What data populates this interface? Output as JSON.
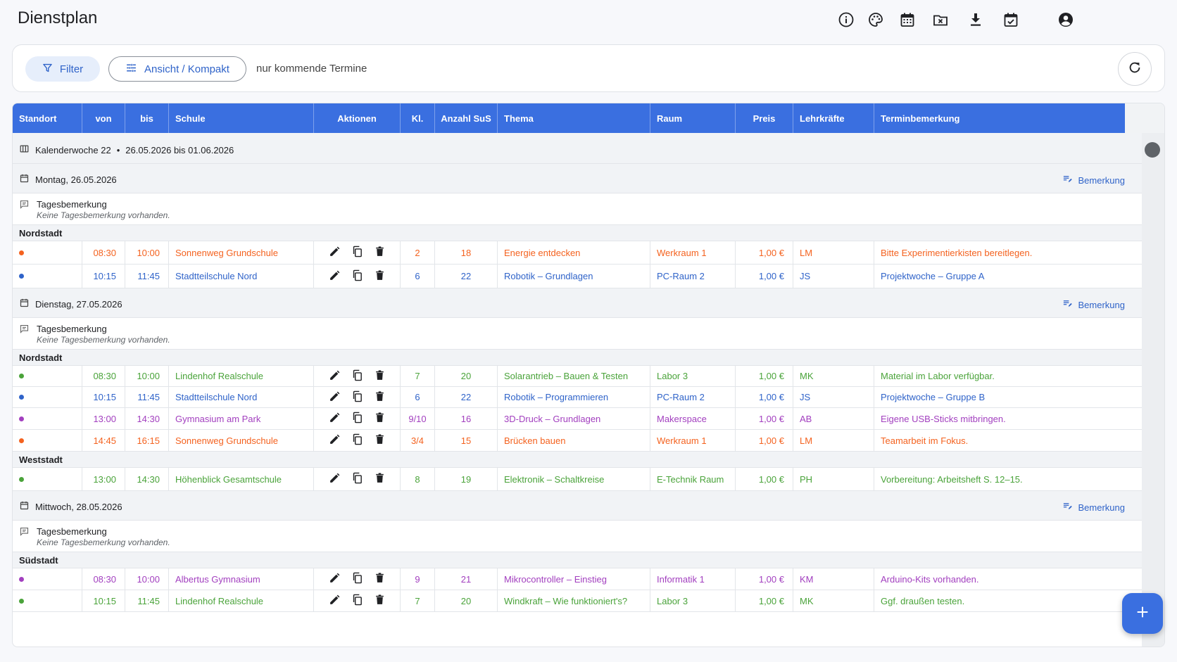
{
  "app": {
    "title": "Dienstplan"
  },
  "header_icons": [
    "info-icon",
    "palette-icon",
    "calendar-icon",
    "folder-x-icon",
    "download-icon",
    "calendar-check-icon",
    "account-icon"
  ],
  "toolbar": {
    "filter_label": "Filter",
    "view_label": "Ansicht / Kompakt",
    "note": "nur kommende Termine"
  },
  "columns": {
    "standort": "Standort",
    "von": "von",
    "bis": "bis",
    "schule": "Schule",
    "aktionen": "Aktionen",
    "kl": "Kl.",
    "anzahl": "Anzahl SuS",
    "thema": "Thema",
    "raum": "Raum",
    "preis": "Preis",
    "lehrkraefte": "Lehrkräfte",
    "bemerkung": "Terminbemerkung"
  },
  "week": {
    "label": "Kalenderwoche 22",
    "sep": "•",
    "range": "26.05.2026 bis 01.06.2026"
  },
  "labels": {
    "remark": "Bemerkung",
    "day_note_title": "Tagesbemerkung",
    "day_note_empty": "Keine Tagesbemerkung vorhanden."
  },
  "colors": {
    "orange": "#f4621f",
    "blue": "#2f63c9",
    "green": "#4aa33a",
    "purple": "#a23fbf",
    "header": "#3a6fe0"
  },
  "days": [
    {
      "date": "Montag, 26.05.2026",
      "groups": [
        {
          "location": "Nordstadt",
          "rows": [
            {
              "color": "orange",
              "von": "08:30",
              "bis": "10:00",
              "schule": "Sonnenweg Grundschule",
              "kl": "2",
              "anzahl": "18",
              "thema": "Energie entdecken",
              "raum": "Werkraum 1",
              "preis": "1,00 €",
              "lehrkraft": "LM",
              "bemerkung": "Bitte Experimentierkisten bereitlegen."
            },
            {
              "color": "blue",
              "von": "10:15",
              "bis": "11:45",
              "schule": "Stadtteilschule Nord",
              "kl": "6",
              "anzahl": "22",
              "thema": "Robotik – Grundlagen",
              "raum": "PC-Raum 2",
              "preis": "1,00 €",
              "lehrkraft": "JS",
              "bemerkung": "Projektwoche – Gruppe A"
            }
          ]
        }
      ]
    },
    {
      "date": "Dienstag, 27.05.2026",
      "groups": [
        {
          "location": "Nordstadt",
          "rows": [
            {
              "color": "green",
              "von": "08:30",
              "bis": "10:00",
              "schule": "Lindenhof Realschule",
              "kl": "7",
              "anzahl": "20",
              "thema": "Solarantrieb – Bauen & Testen",
              "raum": "Labor 3",
              "preis": "1,00 €",
              "lehrkraft": "MK",
              "bemerkung": "Material im Labor verfügbar."
            },
            {
              "color": "blue",
              "von": "10:15",
              "bis": "11:45",
              "schule": "Stadtteilschule Nord",
              "kl": "6",
              "anzahl": "22",
              "thema": "Robotik – Programmieren",
              "raum": "PC-Raum 2",
              "preis": "1,00 €",
              "lehrkraft": "JS",
              "bemerkung": "Projektwoche – Gruppe B"
            },
            {
              "color": "purple",
              "von": "13:00",
              "bis": "14:30",
              "schule": "Gymnasium am Park",
              "kl": "9/10",
              "anzahl": "16",
              "thema": "3D-Druck – Grundlagen",
              "raum": "Makerspace",
              "preis": "1,00 €",
              "lehrkraft": "AB",
              "bemerkung": "Eigene USB-Sticks mitbringen."
            },
            {
              "color": "orange",
              "von": "14:45",
              "bis": "16:15",
              "schule": "Sonnenweg Grundschule",
              "kl": "3/4",
              "anzahl": "15",
              "thema": "Brücken bauen",
              "raum": "Werkraum 1",
              "preis": "1,00 €",
              "lehrkraft": "LM",
              "bemerkung": "Teamarbeit im Fokus."
            }
          ]
        },
        {
          "location": "Weststadt",
          "rows": [
            {
              "color": "green",
              "von": "13:00",
              "bis": "14:30",
              "schule": "Höhenblick Gesamtschule",
              "kl": "8",
              "anzahl": "19",
              "thema": "Elektronik – Schaltkreise",
              "raum": "E-Technik Raum",
              "preis": "1,00 €",
              "lehrkraft": "PH",
              "bemerkung": "Vorbereitung: Arbeitsheft S. 12–15."
            }
          ]
        }
      ]
    },
    {
      "date": "Mittwoch, 28.05.2026",
      "groups": [
        {
          "location": "Südstadt",
          "rows": [
            {
              "color": "purple",
              "von": "08:30",
              "bis": "10:00",
              "schule": "Albertus Gymnasium",
              "kl": "9",
              "anzahl": "21",
              "thema": "Mikrocontroller – Einstieg",
              "raum": "Informatik 1",
              "preis": "1,00 €",
              "lehrkraft": "KM",
              "bemerkung": "Arduino-Kits vorhanden."
            },
            {
              "color": "green",
              "von": "10:15",
              "bis": "11:45",
              "schule": "Lindenhof Realschule",
              "kl": "7",
              "anzahl": "20",
              "thema": "Windkraft – Wie funktioniert's?",
              "raum": "Labor 3",
              "preis": "1,00 €",
              "lehrkraft": "MK",
              "bemerkung": "Ggf. draußen testen."
            }
          ]
        }
      ]
    }
  ]
}
